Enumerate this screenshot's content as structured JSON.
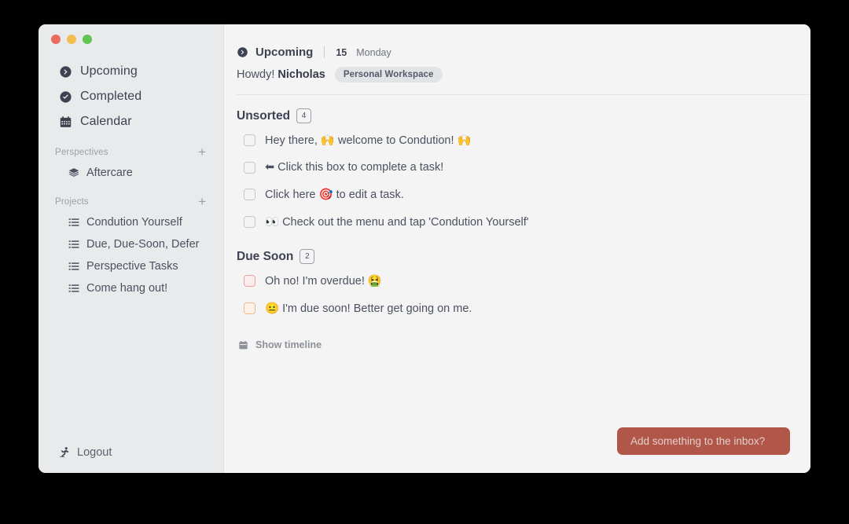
{
  "window": {
    "traffic_lights": [
      {
        "name": "close",
        "color": "#eb6a5e"
      },
      {
        "name": "minimize",
        "color": "#f4bd4f"
      },
      {
        "name": "maximize",
        "color": "#61c555"
      }
    ]
  },
  "sidebar": {
    "nav": [
      {
        "label": "Upcoming",
        "icon": "arrow-circle-right-icon"
      },
      {
        "label": "Completed",
        "icon": "check-circle-icon"
      },
      {
        "label": "Calendar",
        "icon": "calendar-icon"
      }
    ],
    "perspectives": {
      "title": "Perspectives",
      "add_label": "+",
      "items": [
        {
          "label": "Aftercare",
          "icon": "layers-icon"
        }
      ]
    },
    "projects": {
      "title": "Projects",
      "add_label": "+",
      "items": [
        {
          "label": "Condution Yourself",
          "icon": "list-icon"
        },
        {
          "label": "Due, Due-Soon, Defer",
          "icon": "list-icon"
        },
        {
          "label": "Perspective Tasks",
          "icon": "list-icon"
        },
        {
          "label": "Come hang out!",
          "icon": "list-icon"
        }
      ]
    },
    "logout": {
      "label": "Logout",
      "icon": "logout-runner-icon"
    }
  },
  "header": {
    "breadcrumb_title": "Upcoming",
    "breadcrumb_icon": "arrow-circle-right-icon",
    "date_number": "15",
    "date_weekday": "Monday",
    "greeting_prefix": "Howdy!",
    "user_name": "Nicholas",
    "workspace_pill": "Personal Workspace"
  },
  "groups": [
    {
      "title": "Unsorted",
      "count": "4",
      "tasks": [
        {
          "text": "Hey there, 🙌 welcome to Condution! 🙌",
          "state": "normal"
        },
        {
          "text": "⬅ Click this box to complete a task!",
          "state": "normal"
        },
        {
          "text": "Click here 🎯 to edit a task.",
          "state": "normal"
        },
        {
          "text": "👀 Check out the menu and tap 'Condution Yourself'",
          "state": "normal"
        }
      ]
    },
    {
      "title": "Due Soon",
      "count": "2",
      "tasks": [
        {
          "text": "Oh no! I'm overdue! 🤮",
          "state": "overdue"
        },
        {
          "text": "😐 I'm due soon! Better get going on me.",
          "state": "duesoon"
        }
      ]
    }
  ],
  "timeline": {
    "label": "Show timeline",
    "icon": "calendar-icon"
  },
  "inbox_button": {
    "label": "Add something to the inbox?",
    "color": "#b1574a"
  }
}
